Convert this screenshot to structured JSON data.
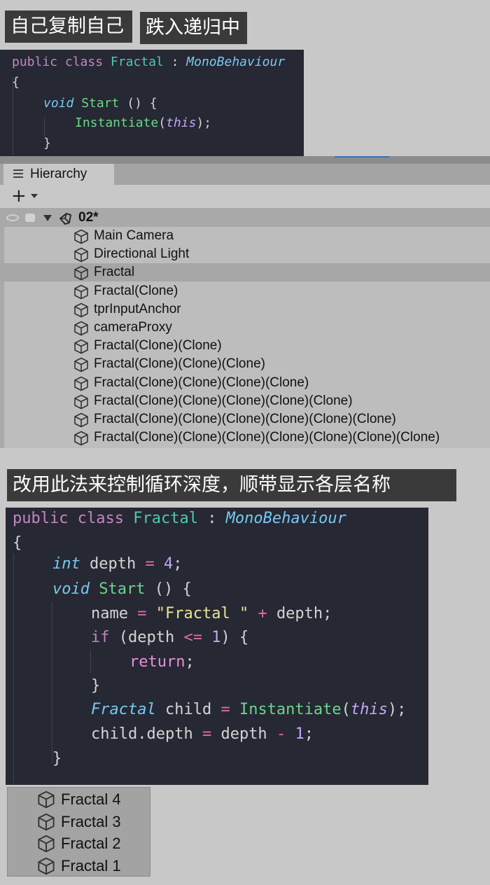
{
  "caption_top_1": "自己复制自己",
  "caption_top_2": "跌入递归中",
  "code1": {
    "l1": {
      "a": "public",
      "b": "class",
      "c": "Fractal",
      "d": ":",
      "e": "MonoBehaviour"
    },
    "l2": "{",
    "l3": {
      "a": "void",
      "b": "Start",
      "c": "() {"
    },
    "l4": {
      "a": "Instantiate",
      "b": "(",
      "c": "this",
      "d": ");"
    },
    "l5": "}"
  },
  "hierarchy": {
    "tab_label": "Hierarchy",
    "add_label": "+",
    "scene_name": "02*",
    "items": [
      {
        "label": "Main Camera",
        "selected": false
      },
      {
        "label": "Directional Light",
        "selected": false
      },
      {
        "label": "Fractal",
        "selected": true
      },
      {
        "label": "Fractal(Clone)",
        "selected": false
      },
      {
        "label": "tprInputAnchor",
        "selected": false
      },
      {
        "label": "cameraProxy",
        "selected": false
      },
      {
        "label": "Fractal(Clone)(Clone)",
        "selected": false
      },
      {
        "label": "Fractal(Clone)(Clone)(Clone)",
        "selected": false
      },
      {
        "label": "Fractal(Clone)(Clone)(Clone)(Clone)",
        "selected": false
      },
      {
        "label": "Fractal(Clone)(Clone)(Clone)(Clone)(Clone)",
        "selected": false
      },
      {
        "label": "Fractal(Clone)(Clone)(Clone)(Clone)(Clone)(Clone)",
        "selected": false
      },
      {
        "label": "Fractal(Clone)(Clone)(Clone)(Clone)(Clone)(Clone)(Clone)",
        "selected": false
      }
    ]
  },
  "caption_mid": "改用此法来控制循环深度，顺带显示各层名称",
  "code2": {
    "l1": {
      "a": "public",
      "b": "class",
      "c": "Fractal",
      "d": ":",
      "e": "MonoBehaviour"
    },
    "l2": "{",
    "l3": {
      "a": "int",
      "b": "depth",
      "c": "=",
      "d": "4",
      "e": ";"
    },
    "l4": {
      "a": "void",
      "b": "Start",
      "c": "() {"
    },
    "l5": {
      "a": "name",
      "b": "=",
      "c": "\"Fractal \"",
      "d": "+",
      "e": "depth;"
    },
    "l6": {
      "a": "if",
      "b": "(depth",
      "c": "<=",
      "d": "1",
      "e": ") {"
    },
    "l7": {
      "a": "return",
      "b": ";"
    },
    "l8": "}",
    "l9": {
      "a": "Fractal",
      "b": "child",
      "c": "=",
      "d": "Instantiate",
      "e": "(",
      "f": "this",
      "g": ");"
    },
    "l10": {
      "a": "child.depth",
      "b": "=",
      "c": "depth",
      "d": "-",
      "e": "1",
      "f": ";"
    },
    "l11": "}"
  },
  "mini_hierarchy": [
    "Fractal 4",
    "Fractal 3",
    "Fractal 2",
    "Fractal 1"
  ],
  "colors": {
    "code_bg": "#262833",
    "keyword": "#c586c0",
    "type": "#4ec9b0",
    "function": "#6bd68a",
    "number": "#c3a6f7",
    "string": "#ece38f"
  }
}
